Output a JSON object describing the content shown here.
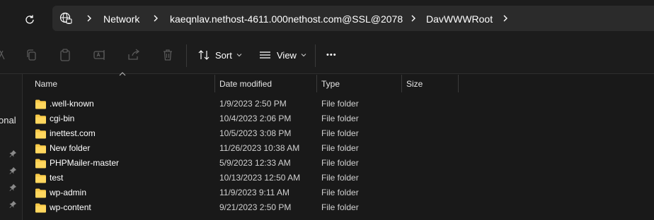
{
  "address_bar": {
    "crumbs": [
      "Network",
      "kaeqnlav.nethost-4611.000nethost.com@SSL@2078",
      "DavWWWRoot"
    ]
  },
  "toolbar": {
    "sort_label": "Sort",
    "view_label": "View",
    "more_label": "•••"
  },
  "nav": {
    "partial_label": "onal"
  },
  "columns": {
    "name": "Name",
    "date": "Date modified",
    "type": "Type",
    "size": "Size"
  },
  "files": [
    {
      "name": ".well-known",
      "date": "1/9/2023 2:50 PM",
      "type": "File folder"
    },
    {
      "name": "cgi-bin",
      "date": "10/4/2023 2:06 PM",
      "type": "File folder"
    },
    {
      "name": "inettest.com",
      "date": "10/5/2023 3:08 PM",
      "type": "File folder"
    },
    {
      "name": "New folder",
      "date": "11/26/2023 10:38 AM",
      "type": "File folder"
    },
    {
      "name": "PHPMailer-master",
      "date": "5/9/2023 12:33 AM",
      "type": "File folder"
    },
    {
      "name": "test",
      "date": "10/13/2023 12:50 AM",
      "type": "File folder"
    },
    {
      "name": "wp-admin",
      "date": "11/9/2023 9:11 AM",
      "type": "File folder"
    },
    {
      "name": "wp-content",
      "date": "9/21/2023 2:50 PM",
      "type": "File folder"
    }
  ],
  "colors": {
    "background": "#191919",
    "chrome": "#1c1c1c",
    "address_box": "#2b2b2b",
    "folder_yellow": "#f8c948"
  }
}
